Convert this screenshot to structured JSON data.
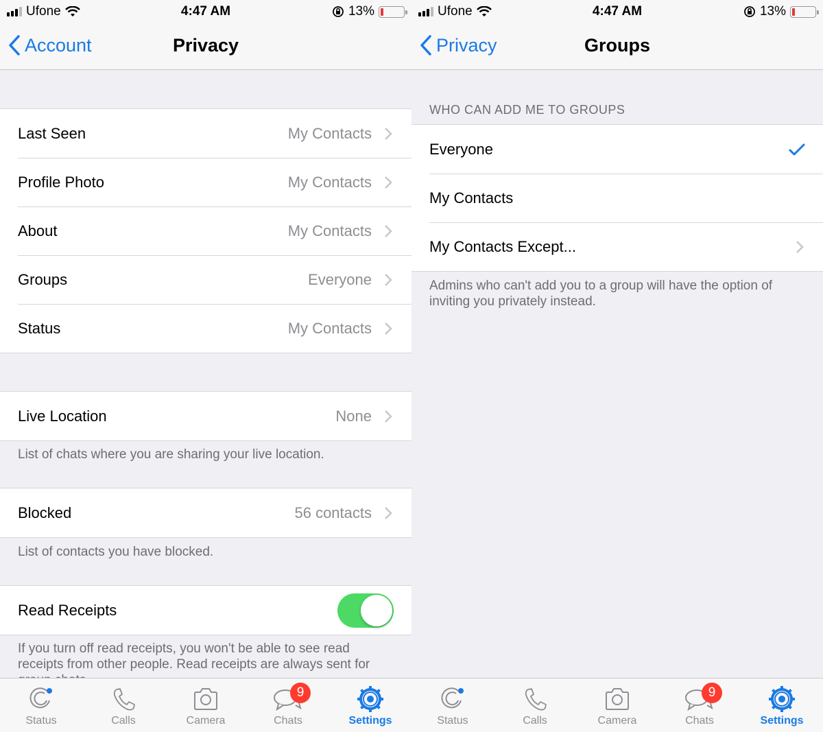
{
  "colors": {
    "accent": "#1a7ae4",
    "toggle_on": "#4cd964",
    "badge": "#ff3b30",
    "battery_low": "#e53935",
    "secondary_text": "#8e8e93"
  },
  "status_bar": {
    "carrier": "Ufone",
    "time": "4:47 AM",
    "battery_percent": "13%",
    "battery_level": 0.13,
    "icons": [
      "signal-icon",
      "wifi-icon",
      "rotation-lock-icon",
      "battery-icon"
    ]
  },
  "left": {
    "nav": {
      "back_label": "Account",
      "title": "Privacy"
    },
    "rows_main": [
      {
        "label": "Last Seen",
        "value": "My Contacts"
      },
      {
        "label": "Profile Photo",
        "value": "My Contacts"
      },
      {
        "label": "About",
        "value": "My Contacts"
      },
      {
        "label": "Groups",
        "value": "Everyone"
      },
      {
        "label": "Status",
        "value": "My Contacts"
      }
    ],
    "live_location": {
      "label": "Live Location",
      "value": "None",
      "footer": "List of chats where you are sharing your live location."
    },
    "blocked": {
      "label": "Blocked",
      "value": "56 contacts",
      "footer": "List of contacts you have blocked."
    },
    "read_receipts": {
      "label": "Read Receipts",
      "enabled": true,
      "footer": "If you turn off read receipts, you won't be able to see read receipts from other people. Read receipts are always sent for group chats."
    }
  },
  "right": {
    "nav": {
      "back_label": "Privacy",
      "title": "Groups"
    },
    "section_header": "WHO CAN ADD ME TO GROUPS",
    "options": [
      {
        "label": "Everyone",
        "selected": true
      },
      {
        "label": "My Contacts",
        "selected": false
      },
      {
        "label": "My Contacts Except...",
        "selected": false,
        "has_chevron": true
      }
    ],
    "footer": "Admins who can't add you to a group will have the option of inviting you privately instead."
  },
  "tabbar": {
    "tabs": [
      {
        "label": "Status",
        "icon": "status-icon"
      },
      {
        "label": "Calls",
        "icon": "phone-icon"
      },
      {
        "label": "Camera",
        "icon": "camera-icon"
      },
      {
        "label": "Chats",
        "icon": "chats-icon",
        "badge": "9"
      },
      {
        "label": "Settings",
        "icon": "settings-gear-icon",
        "active": true
      }
    ]
  }
}
